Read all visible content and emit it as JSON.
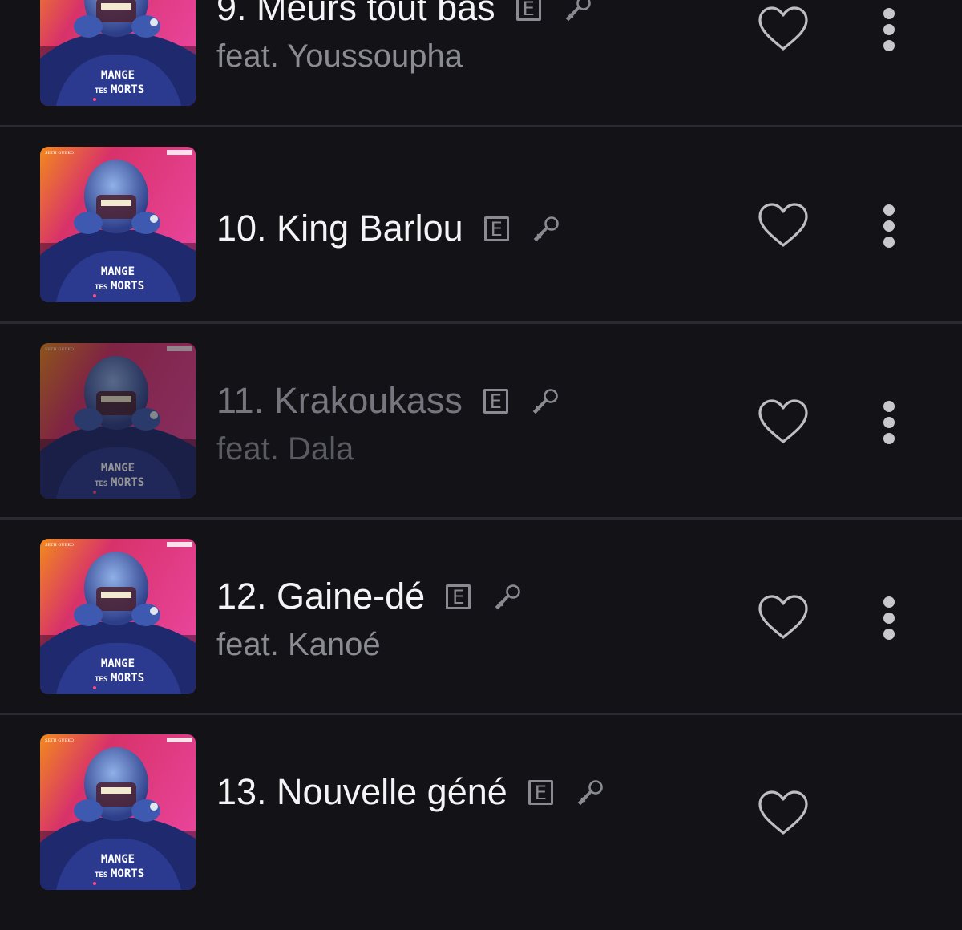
{
  "tracks": [
    {
      "title": "9. Meurs tout bas",
      "featuring": "feat. Youssoupha",
      "explicit_label": "E",
      "dimmed": false
    },
    {
      "title": "10. King Barlou",
      "featuring": "",
      "explicit_label": "E",
      "dimmed": false
    },
    {
      "title": "11. Krakoukass",
      "featuring": "feat. Dala",
      "explicit_label": "E",
      "dimmed": true
    },
    {
      "title": "12. Gaine-dé",
      "featuring": "feat. Kanoé",
      "explicit_label": "E",
      "dimmed": false
    },
    {
      "title": "13. Nouvelle géné",
      "featuring": "",
      "explicit_label": "E",
      "dimmed": false
    }
  ],
  "cover_art": {
    "artist": "SETH GUEKO",
    "album_line1": "MANGE",
    "album_line2": "TES",
    "album_line3": "MORTS"
  },
  "icons": {
    "explicit": "explicit-badge-icon",
    "lyrics": "microphone-icon",
    "like": "heart-outline-icon",
    "more": "more-vertical-icon"
  },
  "colors": {
    "background": "#131317",
    "divider": "#2a2b32",
    "title": "#f4f4f6",
    "subtitle": "#8b8b92",
    "icon": "#8a8a92"
  }
}
